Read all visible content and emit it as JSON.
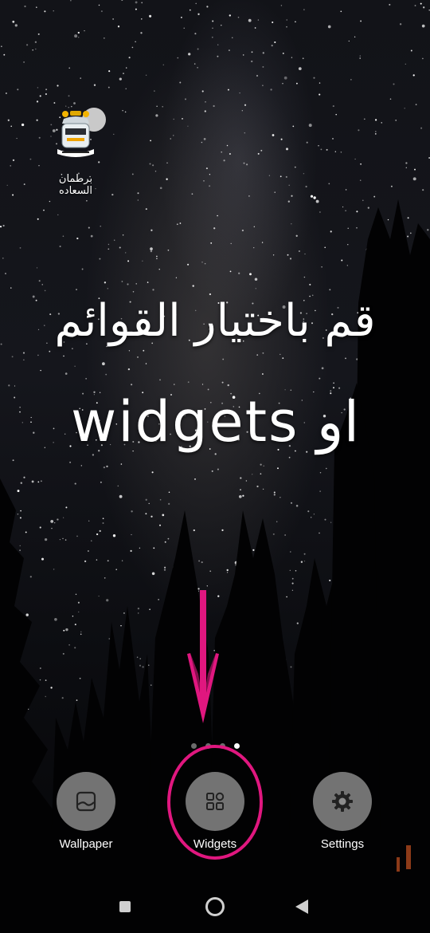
{
  "home_screen": {
    "app": {
      "label": "برطمان السعاده",
      "icon": "jar-logo-icon"
    },
    "instruction": {
      "line1": "قم باختيار القوائم",
      "line2": "او widgets"
    },
    "page_indicator": {
      "count": 4,
      "active_index": 3
    },
    "menu": [
      {
        "label": "Wallpaper",
        "icon": "wallpaper-icon"
      },
      {
        "label": "Widgets",
        "icon": "widgets-grid-icon"
      },
      {
        "label": "Settings",
        "icon": "gear-icon"
      }
    ],
    "annotation": {
      "arrow_color": "#e0177f",
      "highlight_color": "#e0177f"
    }
  },
  "nav_bar": {
    "recents": "recents-square-icon",
    "home": "home-circle-icon",
    "back": "back-triangle-icon"
  }
}
